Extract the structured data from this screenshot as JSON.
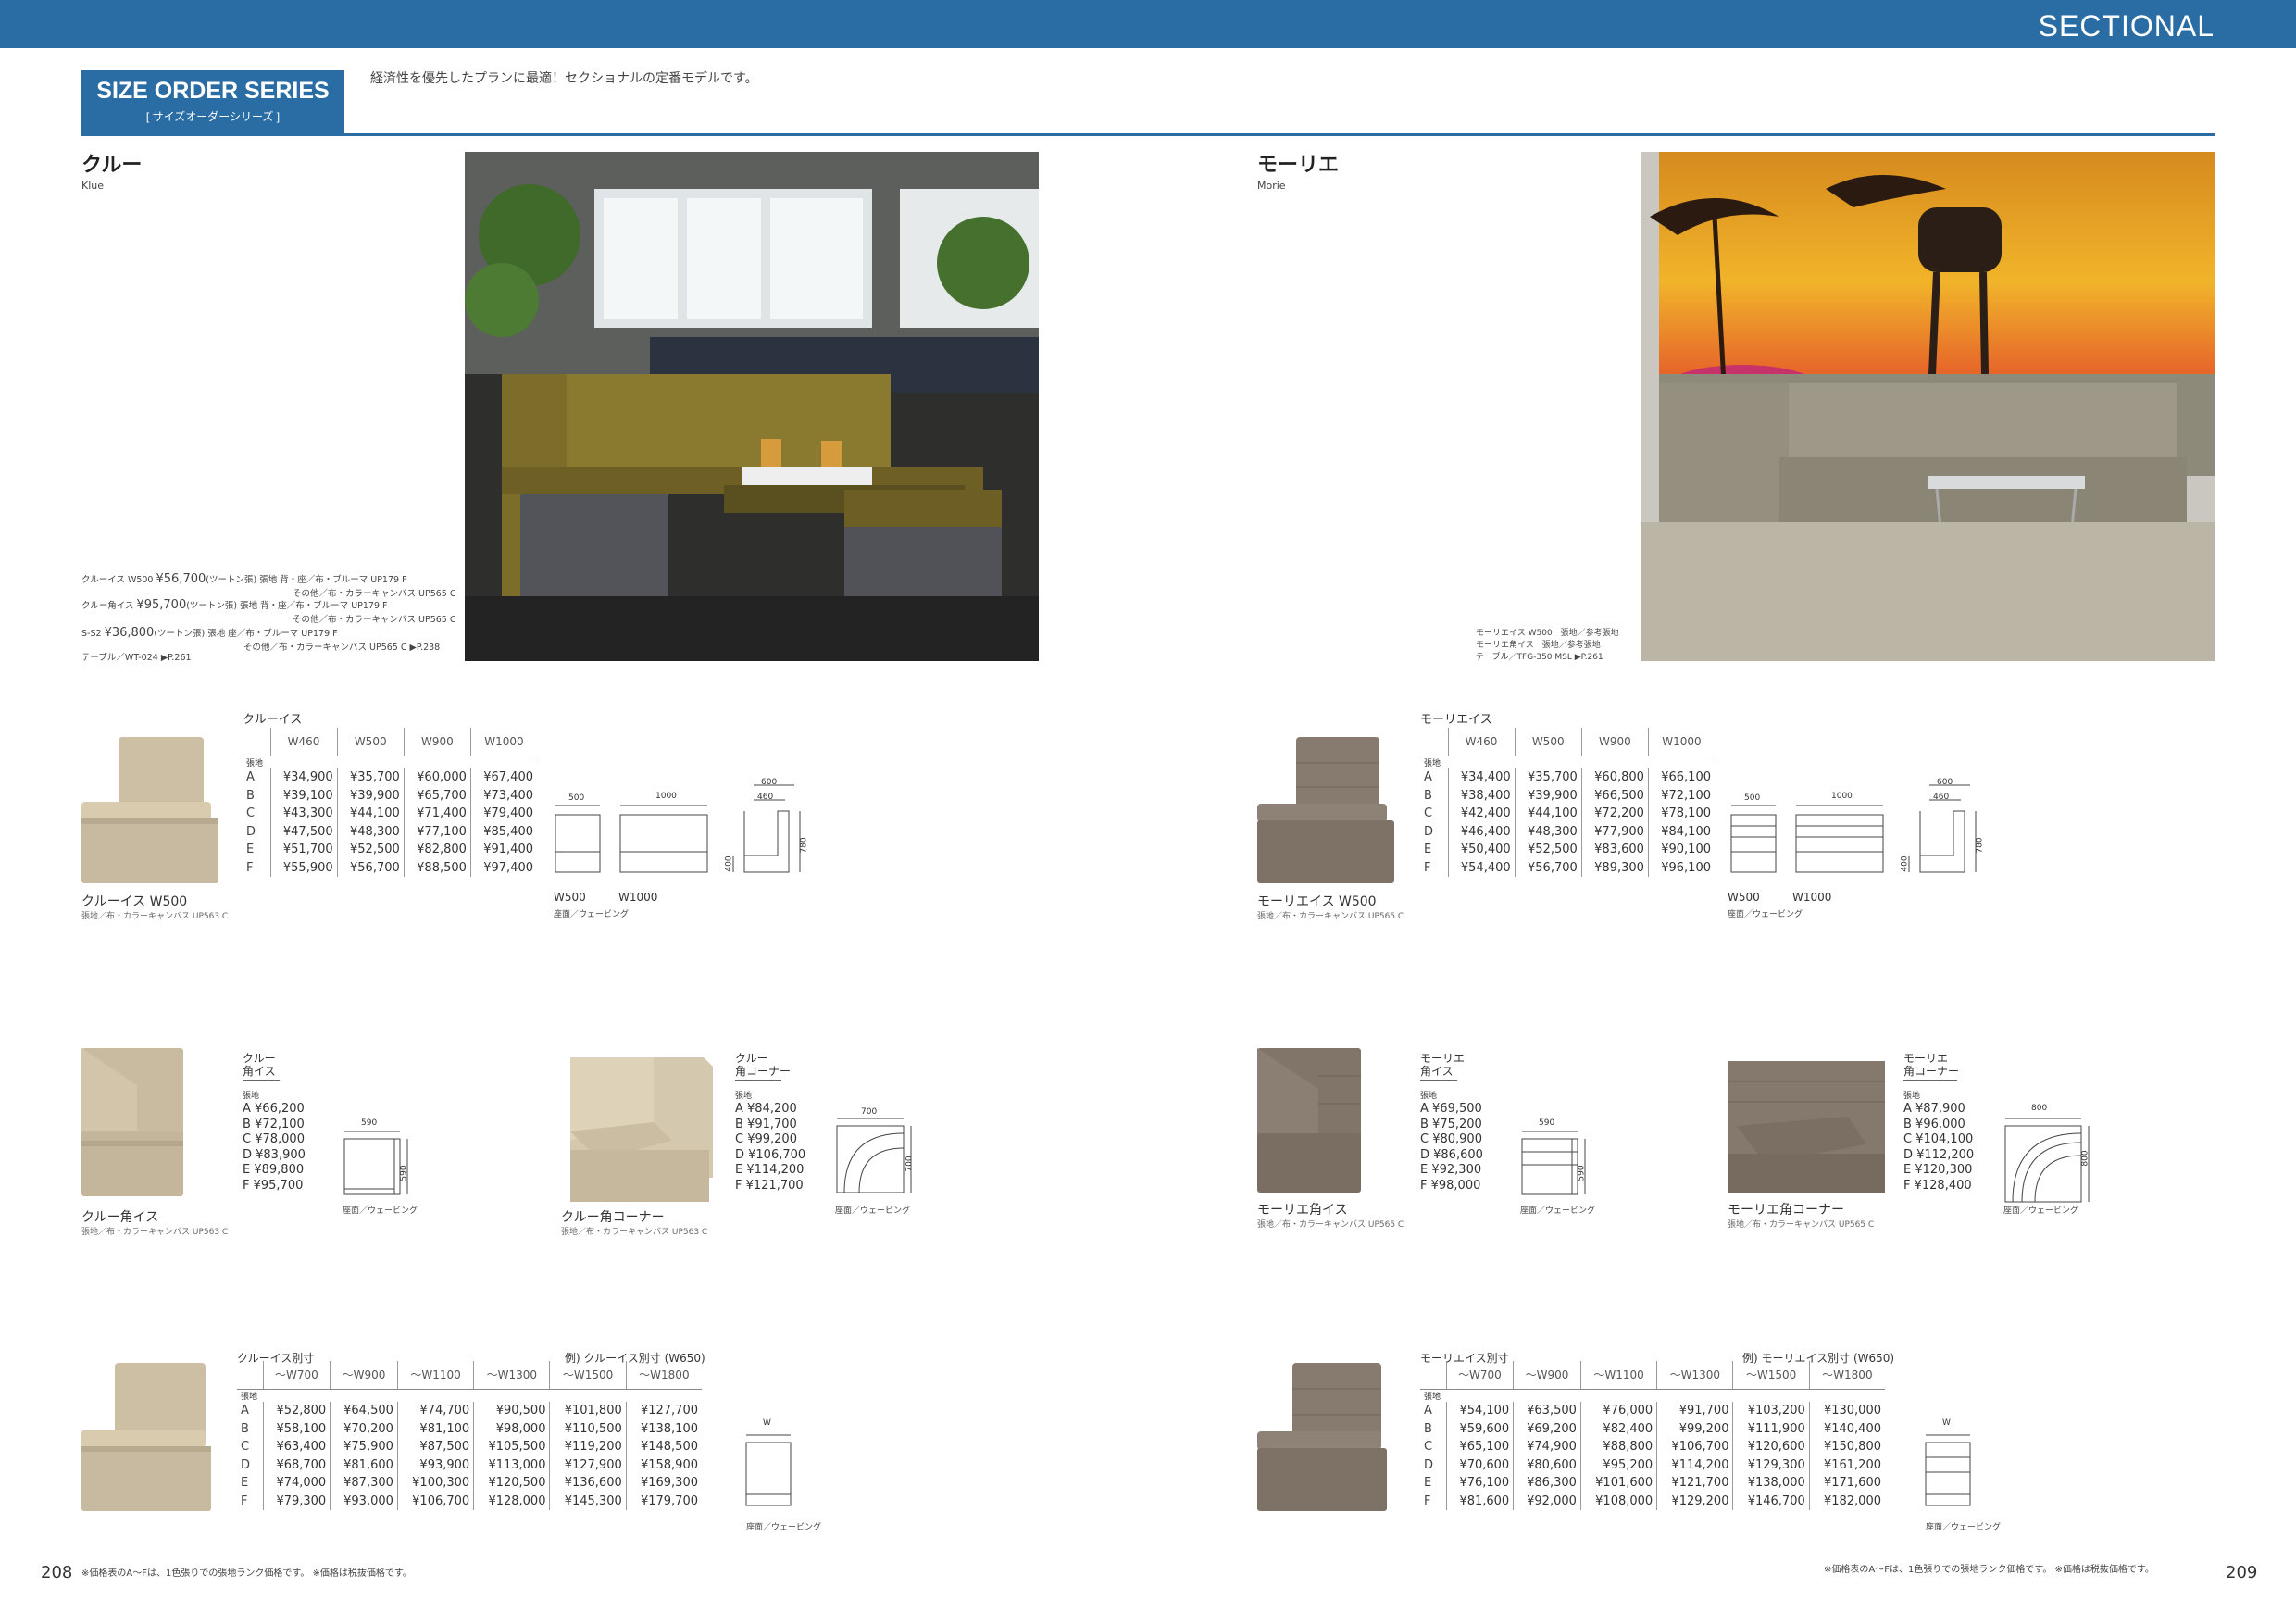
{
  "header": {
    "section": "SECTIONAL"
  },
  "series": {
    "title": "SIZE ORDER SERIES",
    "subtitle": "[ サイズオーダーシリーズ ]",
    "tagline": "経済性を優先したプランに最適！セクショナルの定番モデルです。"
  },
  "left": {
    "name": "クルー",
    "name_en": "Klue",
    "captions": [
      {
        "line1": "クルーイス W500 ",
        "price": "¥56,700",
        "tail": "(ツートン張)  張地 背・座／布・ブルーマ UP179 F",
        "line2": "その他／布・カラーキャンバス UP565 C"
      },
      {
        "line1": "クルー角イス ",
        "price": "¥95,700",
        "tail": "(ツートン張)  張地 背・座／布・ブルーマ UP179 F",
        "line2": "その他／布・カラーキャンバス UP565 C"
      },
      {
        "line1": "S-S2 ",
        "price": "¥36,800",
        "tail": "(ツートン張)  張地 座／布・ブルーマ UP179 F",
        "line2": "その他／布・カラーキャンバス UP565 C ▶P.238"
      }
    ],
    "caption_table": "テーブル／WT-024 ▶P.261",
    "table1": {
      "title": "クルーイス",
      "headers": [
        "W460",
        "W500",
        "W900",
        "W1000"
      ],
      "label": "張地",
      "rows": [
        [
          "A",
          "¥34,900",
          "¥35,700",
          "¥60,000",
          "¥67,400"
        ],
        [
          "B",
          "¥39,100",
          "¥39,900",
          "¥65,700",
          "¥73,400"
        ],
        [
          "C",
          "¥43,300",
          "¥44,100",
          "¥71,400",
          "¥79,400"
        ],
        [
          "D",
          "¥47,500",
          "¥48,300",
          "¥77,100",
          "¥85,400"
        ],
        [
          "E",
          "¥51,700",
          "¥52,500",
          "¥82,800",
          "¥91,400"
        ],
        [
          "F",
          "¥55,900",
          "¥56,700",
          "¥88,500",
          "¥97,400"
        ]
      ]
    },
    "chair1": {
      "label": "クルーイス W500",
      "fabric": "張地／布・カラーキャンバス UP563 C"
    },
    "dims1": {
      "d500": "500",
      "d1000": "1000",
      "d600": "600",
      "d460": "460",
      "d400": "400",
      "d780": "780",
      "w500": "W500",
      "w1000": "W1000",
      "note": "座面／ウェービング"
    },
    "corner_chair": {
      "title1": "クルー",
      "title2": "角イス",
      "label": "張地",
      "prices": "A ¥66,200\nB ¥72,100\nC ¥78,000\nD ¥83,900\nE ¥89,800\nF ¥95,700",
      "name": "クルー角イス",
      "fabric": "張地／布・カラーキャンバス UP563 C",
      "d590": "590",
      "d590b": "590",
      "note": "座面／ウェービング"
    },
    "corner_piece": {
      "title1": "クルー",
      "title2": "角コーナー",
      "label": "張地",
      "prices": "A ¥84,200\nB ¥91,700\nC ¥99,200\nD ¥106,700\nE ¥114,200\nF ¥121,700",
      "name": "クルー角コーナー",
      "fabric": "張地／布・カラーキャンバス UP563 C",
      "d700": "700",
      "d700b": "700",
      "note": "座面／ウェービング"
    },
    "table2": {
      "title": "クルーイス別寸",
      "example": "例) クルーイス別寸 (W650)",
      "headers": [
        "～W700",
        "～W900",
        "～W1100",
        "～W1300",
        "～W1500",
        "～W1800"
      ],
      "label": "張地",
      "rows": [
        [
          "A",
          "¥52,800",
          "¥64,500",
          "¥74,700",
          "¥90,500",
          "¥101,800",
          "¥127,700"
        ],
        [
          "B",
          "¥58,100",
          "¥70,200",
          "¥81,100",
          "¥98,000",
          "¥110,500",
          "¥138,100"
        ],
        [
          "C",
          "¥63,400",
          "¥75,900",
          "¥87,500",
          "¥105,500",
          "¥119,200",
          "¥148,500"
        ],
        [
          "D",
          "¥68,700",
          "¥81,600",
          "¥93,900",
          "¥113,000",
          "¥127,900",
          "¥158,900"
        ],
        [
          "E",
          "¥74,000",
          "¥87,300",
          "¥100,300",
          "¥120,500",
          "¥136,600",
          "¥169,300"
        ],
        [
          "F",
          "¥79,300",
          "¥93,000",
          "¥106,700",
          "¥128,000",
          "¥145,300",
          "¥179,700"
        ]
      ],
      "w": "W",
      "note": "座面／ウェービング"
    },
    "footnote": "※価格表のA～Fは、1色張りでの張地ランク価格です。 ※価格は税抜価格です。",
    "page": "208"
  },
  "right": {
    "name": "モーリエ",
    "name_en": "Morie",
    "captions": [
      "モーリエイス W500　張地／参考張地",
      "モーリエ角イス　張地／参考張地",
      "テーブル／TFG-350 MSL ▶P.261"
    ],
    "table1": {
      "title": "モーリエイス",
      "headers": [
        "W460",
        "W500",
        "W900",
        "W1000"
      ],
      "label": "張地",
      "rows": [
        [
          "A",
          "¥34,400",
          "¥35,700",
          "¥60,800",
          "¥66,100"
        ],
        [
          "B",
          "¥38,400",
          "¥39,900",
          "¥66,500",
          "¥72,100"
        ],
        [
          "C",
          "¥42,400",
          "¥44,100",
          "¥72,200",
          "¥78,100"
        ],
        [
          "D",
          "¥46,400",
          "¥48,300",
          "¥77,900",
          "¥84,100"
        ],
        [
          "E",
          "¥50,400",
          "¥52,500",
          "¥83,600",
          "¥90,100"
        ],
        [
          "F",
          "¥54,400",
          "¥56,700",
          "¥89,300",
          "¥96,100"
        ]
      ]
    },
    "chair1": {
      "label": "モーリエイス W500",
      "fabric": "張地／布・カラーキャンバス UP565 C"
    },
    "dims1": {
      "d500": "500",
      "d1000": "1000",
      "d600": "600",
      "d460": "460",
      "d400": "400",
      "d780": "780",
      "w500": "W500",
      "w1000": "W1000",
      "note": "座面／ウェービング"
    },
    "corner_chair": {
      "title1": "モーリエ",
      "title2": "角イス",
      "label": "張地",
      "prices": "A ¥69,500\nB ¥75,200\nC ¥80,900\nD ¥86,600\nE ¥92,300\nF ¥98,000",
      "name": "モーリエ角イス",
      "fabric": "張地／布・カラーキャンバス UP565 C",
      "d590": "590",
      "d590b": "590",
      "note": "座面／ウェービング"
    },
    "corner_piece": {
      "title1": "モーリエ",
      "title2": "角コーナー",
      "label": "張地",
      "prices": "A ¥87,900\nB ¥96,000\nC ¥104,100\nD ¥112,200\nE ¥120,300\nF ¥128,400",
      "name": "モーリエ角コーナー",
      "fabric": "張地／布・カラーキャンバス UP565 C",
      "d800": "800",
      "d800b": "800",
      "note": "座面／ウェービング"
    },
    "table2": {
      "title": "モーリエイス別寸",
      "example": "例) モーリエイス別寸 (W650)",
      "headers": [
        "～W700",
        "～W900",
        "～W1100",
        "～W1300",
        "～W1500",
        "～W1800"
      ],
      "label": "張地",
      "rows": [
        [
          "A",
          "¥54,100",
          "¥63,500",
          "¥76,000",
          "¥91,700",
          "¥103,200",
          "¥130,000"
        ],
        [
          "B",
          "¥59,600",
          "¥69,200",
          "¥82,400",
          "¥99,200",
          "¥111,900",
          "¥140,400"
        ],
        [
          "C",
          "¥65,100",
          "¥74,900",
          "¥88,800",
          "¥106,700",
          "¥120,600",
          "¥150,800"
        ],
        [
          "D",
          "¥70,600",
          "¥80,600",
          "¥95,200",
          "¥114,200",
          "¥129,300",
          "¥161,200"
        ],
        [
          "E",
          "¥76,100",
          "¥86,300",
          "¥101,600",
          "¥121,700",
          "¥138,000",
          "¥171,600"
        ],
        [
          "F",
          "¥81,600",
          "¥92,000",
          "¥108,000",
          "¥129,200",
          "¥146,700",
          "¥182,000"
        ]
      ],
      "w": "W",
      "note": "座面／ウェービング"
    },
    "footnote": "※価格表のA～Fは、1色張りでの張地ランク価格です。 ※価格は税抜価格です。",
    "page": "209"
  }
}
